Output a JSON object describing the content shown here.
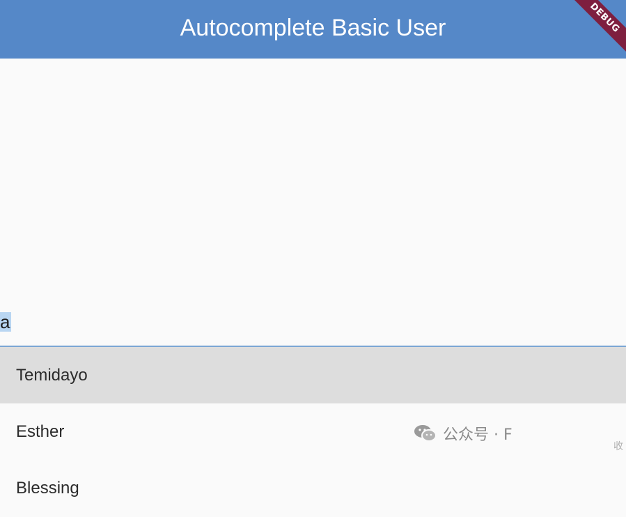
{
  "app_bar": {
    "title": "Autocomplete Basic User",
    "color": "#5588c8"
  },
  "debug_banner": {
    "label": "DEBUG",
    "color": "#7e1f3f"
  },
  "search_field": {
    "value": "a",
    "underline_color": "#7aa6d4",
    "selection_color": "#b9d6f2"
  },
  "options": [
    {
      "label": "Temidayo",
      "highlighted": true
    },
    {
      "label": "Esther",
      "highlighted": false
    },
    {
      "label": "Blessing",
      "highlighted": false
    }
  ],
  "watermark": {
    "icon": "wechat-icon",
    "text": "公众号 · F"
  },
  "corner_mark": "收"
}
